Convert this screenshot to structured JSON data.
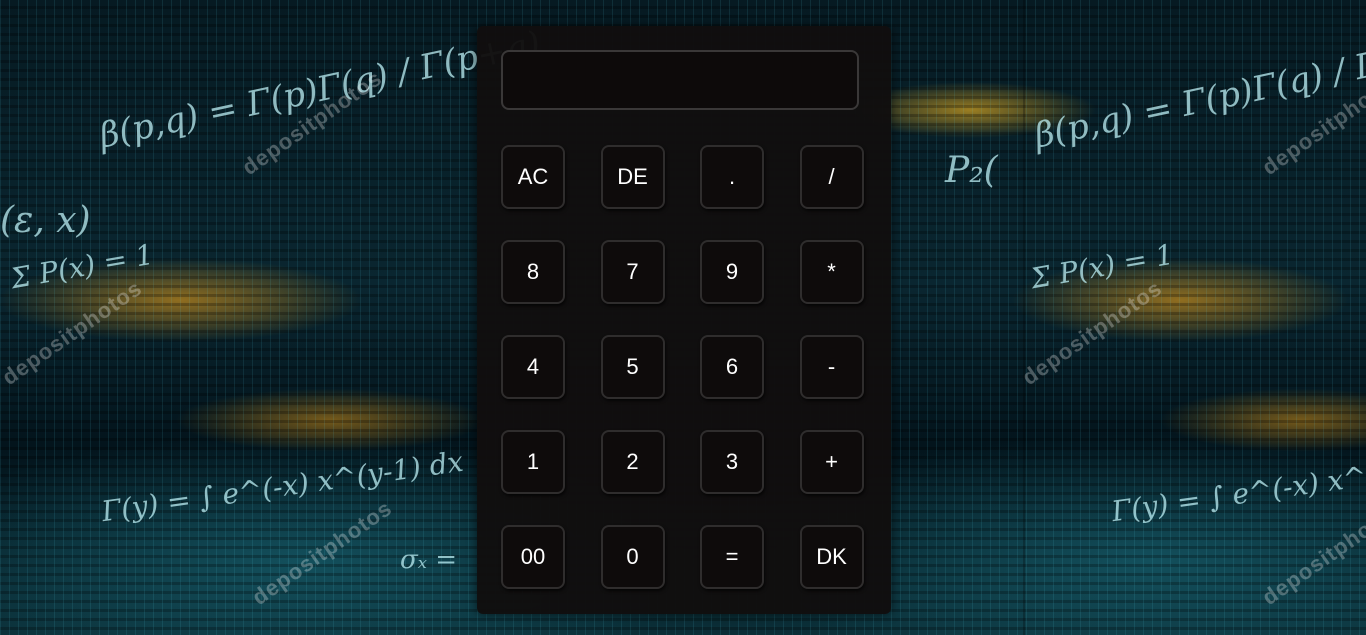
{
  "calculator": {
    "display_value": "",
    "keys": [
      [
        "AC",
        "DE",
        ".",
        "/"
      ],
      [
        "8",
        "7",
        "9",
        "*"
      ],
      [
        "4",
        "5",
        "6",
        "-"
      ],
      [
        "1",
        "2",
        "3",
        "+"
      ],
      [
        "00",
        "0",
        "=",
        "DK"
      ]
    ]
  },
  "background": {
    "formulas": [
      "β(p,q) = Γ(p)Γ(q) / Γ(p+q)",
      "Σ P(x) = 1",
      "Γ(y) = ∫ e^(-x) x^(y-1) dx",
      "P₂(",
      "(ε, x)",
      "σₓ ="
    ],
    "watermark": "depositphotos"
  },
  "colors": {
    "panel": "#110e0e",
    "key_bg": "#0e0b0b",
    "key_border": "#2f2d2d",
    "text": "#ffffff",
    "glow": "#ffaa14",
    "matrix": "#5ad2e6"
  }
}
